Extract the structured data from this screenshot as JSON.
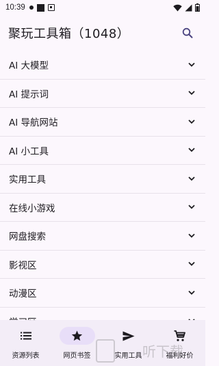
{
  "status_bar": {
    "time": "10:39"
  },
  "app_bar": {
    "title": "聚玩工具箱（1048）"
  },
  "categories": [
    {
      "label": "AI 大模型"
    },
    {
      "label": "AI 提示词"
    },
    {
      "label": "AI 导航网站"
    },
    {
      "label": "AI 小工具"
    },
    {
      "label": "实用工具"
    },
    {
      "label": "在线小游戏"
    },
    {
      "label": "网盘搜索"
    },
    {
      "label": "影视区"
    },
    {
      "label": "动漫区"
    },
    {
      "label": "学习区"
    }
  ],
  "bottom_nav": [
    {
      "label": "资源列表",
      "icon": "list-icon"
    },
    {
      "label": "网页书签",
      "icon": "star-icon",
      "active": true
    },
    {
      "label": "实用工具",
      "icon": "send-icon"
    },
    {
      "label": "福利好价",
      "icon": "cart-icon"
    }
  ],
  "watermark": {
    "text": "听下载"
  },
  "colors": {
    "accent": "#e8def8",
    "background": "#fcf7fd",
    "nav_background": "#f3edf7",
    "search_icon": "#4a4380"
  }
}
